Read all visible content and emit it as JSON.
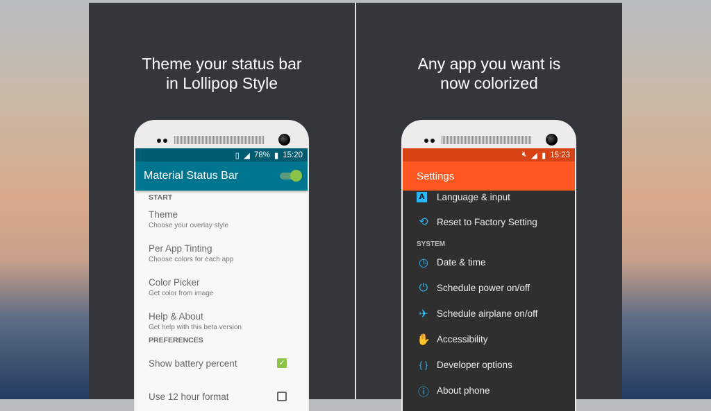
{
  "left": {
    "headline_line1": "Theme your status bar",
    "headline_line2": "in Lollipop Style",
    "status": {
      "battery_percent": "78%",
      "time": "15:20",
      "color": "#005a70"
    },
    "app_title": "Material Status Bar",
    "toolbar_color": "#00758f",
    "master_toggle_on": true,
    "sections": [
      {
        "header": "START"
      },
      {
        "header": "PREFERENCES"
      }
    ],
    "items": [
      {
        "title": "Theme",
        "subtitle": "Choose your overlay style"
      },
      {
        "title": "Per App Tinting",
        "subtitle": "Choose colors for each app"
      },
      {
        "title": "Color Picker",
        "subtitle": "Get color from image"
      },
      {
        "title": "Help & About",
        "subtitle": "Get help with this beta version"
      }
    ],
    "prefs": [
      {
        "label": "Show battery percent",
        "checked": true
      },
      {
        "label": "Use 12 hour format",
        "checked": false
      }
    ]
  },
  "right": {
    "headline_line1": "Any app you want is",
    "headline_line2": "now colorized",
    "status": {
      "time": "15:23",
      "color": "#d84315"
    },
    "app_title": "Settings",
    "toolbar_color": "#ff5722",
    "items_top": [
      {
        "icon": "language-icon",
        "glyph": "A",
        "label": "Language & input"
      },
      {
        "icon": "reset-icon",
        "glyph": "⟲",
        "label": "Reset to Factory Setting"
      }
    ],
    "section": "SYSTEM",
    "items": [
      {
        "icon": "clock-icon",
        "glyph": "◷",
        "label": "Date & time"
      },
      {
        "icon": "power-schedule-icon",
        "glyph": "⏻",
        "label": "Schedule power on/off"
      },
      {
        "icon": "airplane-icon",
        "glyph": "✈",
        "label": "Schedule airplane on/off"
      },
      {
        "icon": "hand-icon",
        "glyph": "✋",
        "label": "Accessibility"
      },
      {
        "icon": "braces-icon",
        "glyph": "{ }",
        "label": "Developer options"
      },
      {
        "icon": "info-icon",
        "glyph": "ⓘ",
        "label": "About phone"
      }
    ]
  }
}
